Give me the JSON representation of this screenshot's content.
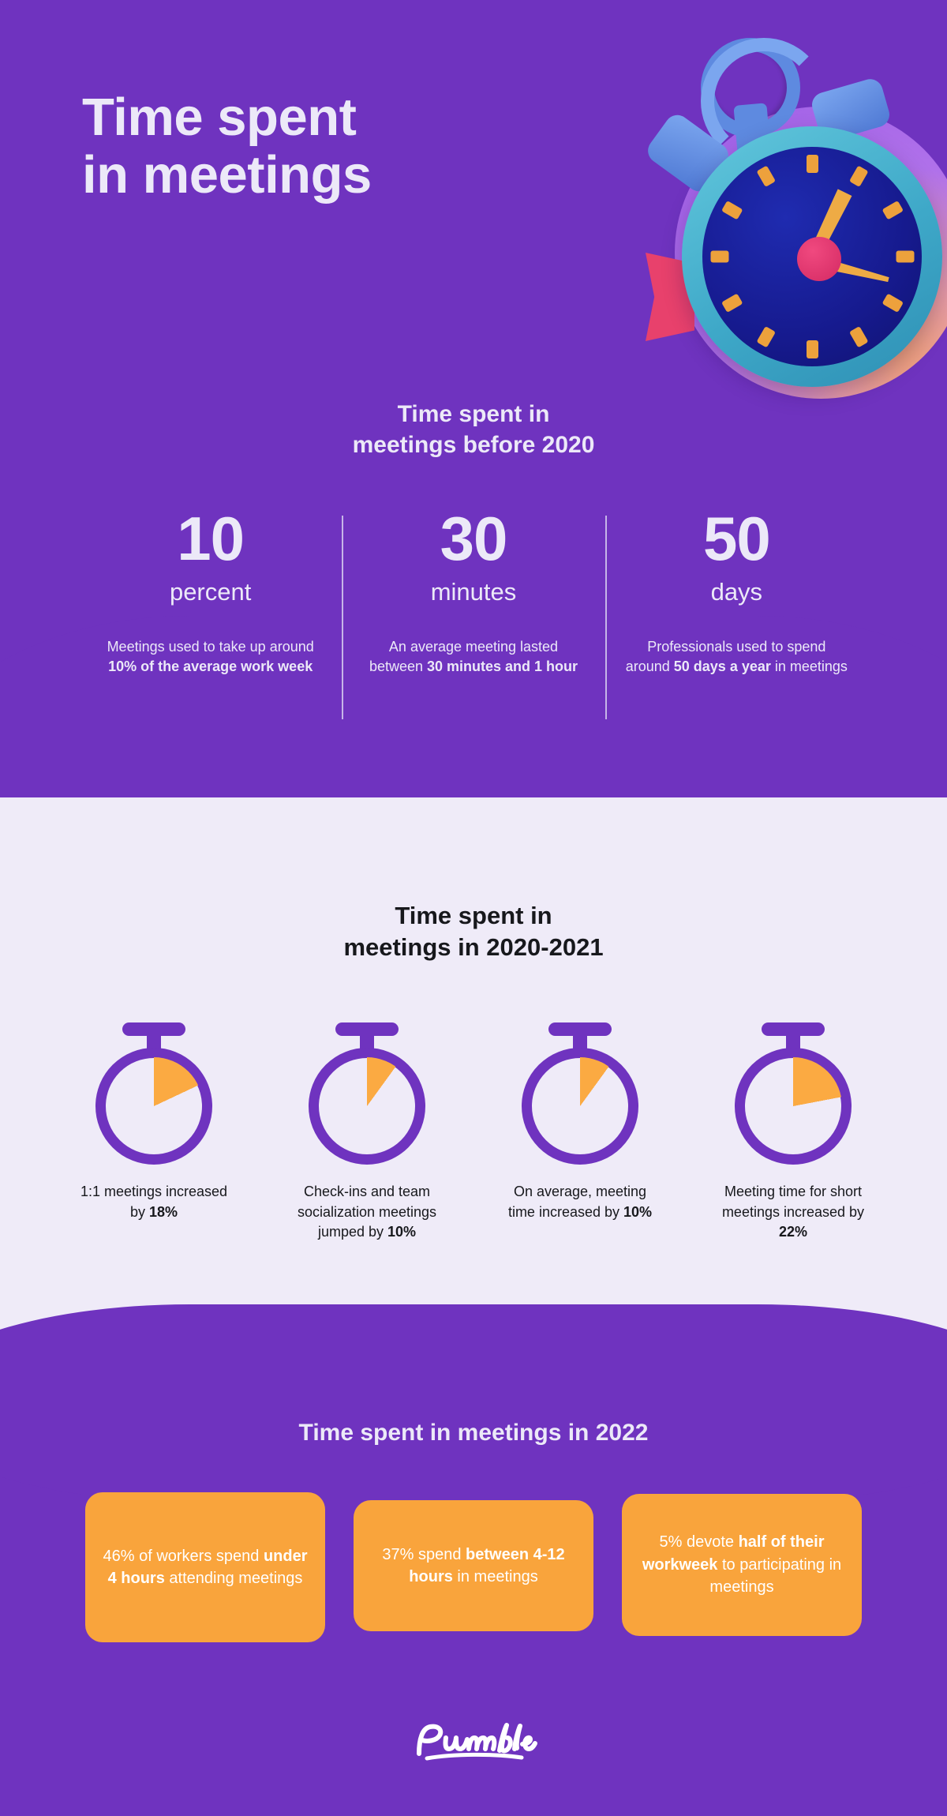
{
  "hero": {
    "title_line1": "Time spent",
    "title_line2": "in meetings",
    "subheading_line1": "Time spent in",
    "subheading_line2": "meetings before 2020",
    "illustration_name": "3d-stopwatch-illustration",
    "stats": [
      {
        "number": "10",
        "unit": "percent",
        "desc_pre": "Meetings used to take up around ",
        "desc_bold": "10% of the average work week",
        "desc_post": ""
      },
      {
        "number": "30",
        "unit": "minutes",
        "desc_pre": "An average meeting lasted between ",
        "desc_bold": "30 minutes and 1 hour",
        "desc_post": ""
      },
      {
        "number": "50",
        "unit": "days",
        "desc_pre": "Professionals used to spend around ",
        "desc_bold": "50 days a year",
        "desc_post": " in meetings"
      }
    ]
  },
  "mid": {
    "title_line1": "Time spent in",
    "title_line2": "meetings in 2020-2021",
    "items": [
      {
        "icon": "stopwatch-icon",
        "percent": 18,
        "caption_pre": "1:1 meetings increased by ",
        "caption_bold": "18%",
        "caption_post": ""
      },
      {
        "icon": "stopwatch-icon",
        "percent": 10,
        "caption_pre": "Check-ins and team socialization meetings jumped by ",
        "caption_bold": "10%",
        "caption_post": ""
      },
      {
        "icon": "stopwatch-icon",
        "percent": 10,
        "caption_pre": "On average, meeting time increased by ",
        "caption_bold": "10%",
        "caption_post": ""
      },
      {
        "icon": "stopwatch-icon",
        "percent": 22,
        "caption_pre": "Meeting time for short meetings increased by ",
        "caption_bold": "22%",
        "caption_post": ""
      }
    ]
  },
  "bottom": {
    "title": "Time spent in meetings in 2022",
    "cards": [
      {
        "pre": "46% of workers spend ",
        "bold": "under 4 hours",
        "post": " attending meetings"
      },
      {
        "pre": "37% spend ",
        "bold": "between 4-12 hours",
        "post": " in meetings"
      },
      {
        "pre": "5% devote ",
        "bold": "half of their workweek",
        "post": " to participating in meetings"
      }
    ]
  },
  "footer": {
    "brand": "Pumble"
  },
  "chart_data": {
    "type": "bar",
    "title": "Time spent in meetings",
    "series": [
      {
        "name": "Time spent in meetings before 2020",
        "categories": [
          "percent",
          "minutes",
          "days"
        ],
        "values": [
          10,
          30,
          50
        ],
        "units": [
          "percent",
          "minutes",
          "days"
        ]
      },
      {
        "name": "Time spent in meetings in 2020-2021",
        "categories": [
          "1:1 meetings increased by",
          "Check-ins and team socialization meetings jumped by",
          "On average, meeting time increased by",
          "Meeting time for short meetings increased by"
        ],
        "values": [
          18,
          10,
          10,
          22
        ],
        "units": [
          "%",
          "%",
          "%",
          "%"
        ]
      },
      {
        "name": "Time spent in meetings in 2022",
        "categories": [
          "under 4 hours attending meetings",
          "between 4-12 hours in meetings",
          "half of their workweek participating in meetings"
        ],
        "values": [
          46,
          37,
          5
        ],
        "units": [
          "%",
          "%",
          "%"
        ]
      }
    ]
  },
  "colors": {
    "purple": "#6f33bf",
    "light_lavender": "#efebf8",
    "orange": "#f9a43c",
    "text_light": "#ece9f8",
    "text_dark": "#17181c"
  }
}
